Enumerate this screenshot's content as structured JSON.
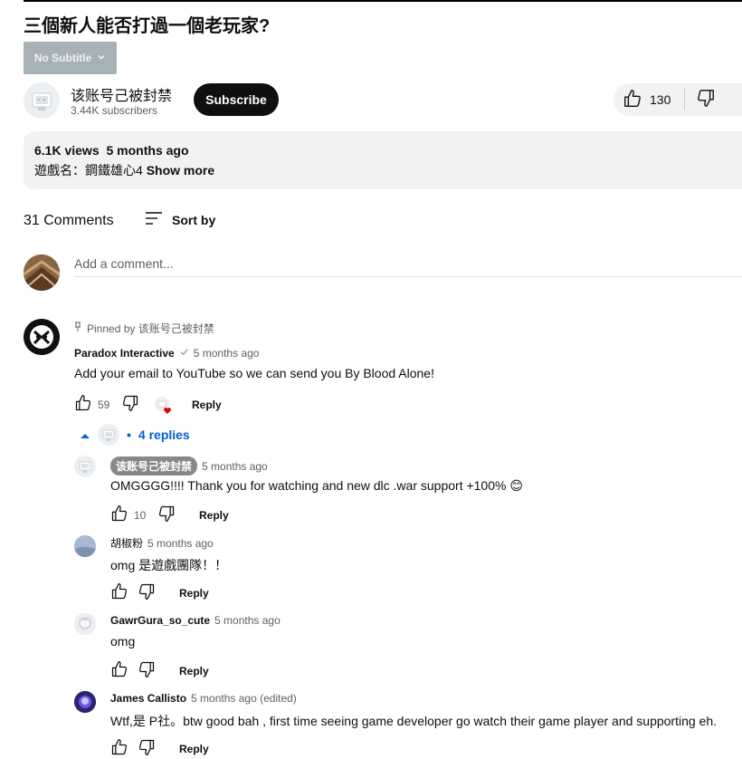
{
  "video": {
    "title": "三個新人能否打過一個老玩家?",
    "subtitle_button": "No Subtitle",
    "channel_name": "该账号己被封禁",
    "subscribers": "3.44K subscribers",
    "subscribe_label": "Subscribe",
    "like_count": "130",
    "views": "6.1K views",
    "age": "5 months ago",
    "description": "遊戲名：鋼鐵雄心4",
    "show_more": "Show more"
  },
  "comments_header": {
    "count_label": "31 Comments",
    "sort_label": "Sort by",
    "add_placeholder": "Add a comment..."
  },
  "pinned_comment": {
    "pinned_label": "Pinned by 该账号己被封禁",
    "author": "Paradox Interactive",
    "verified_icon": "check-icon",
    "time": "5 months ago",
    "text": "Add your email to YouTube so we can send you By Blood Alone!",
    "likes": "59",
    "reply_label": "Reply",
    "replies_label": "4 replies",
    "hearted": true
  },
  "replies": [
    {
      "author": "该账号己被封禁",
      "is_owner": true,
      "time": "5 months ago",
      "text": "OMGGGG!!!! Thank you for watching and new dlc .war support +100% 😊",
      "likes": "10",
      "reply_label": "Reply"
    },
    {
      "author": "胡椒粉",
      "time": "5 months ago",
      "text": "omg 是遊戲團隊！！",
      "likes": "",
      "reply_label": "Reply"
    },
    {
      "author": "GawrGura_so_cute",
      "time": "5 months ago",
      "text": "omg",
      "likes": "",
      "reply_label": "Reply"
    },
    {
      "author": "James Callisto",
      "time": "5 months ago (edited)",
      "text": "Wtf,是 P社。btw good bah , first time seeing game developer go watch their game player and supporting eh.",
      "likes": "",
      "reply_label": "Reply"
    }
  ],
  "colors": {
    "link_blue": "#065fd4",
    "heart_red": "#e00000",
    "pill_bg": "#f2f2f2"
  }
}
